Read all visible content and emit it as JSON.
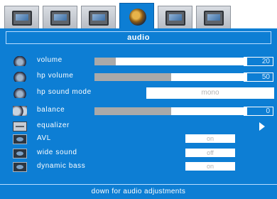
{
  "tabs": [
    {
      "icon": "tv-picture-icon",
      "active": false
    },
    {
      "icon": "tv-icon",
      "active": false
    },
    {
      "icon": "tv-settings-icon",
      "active": false
    },
    {
      "icon": "speaker-icon",
      "active": true
    },
    {
      "icon": "tv-features-icon",
      "active": false
    },
    {
      "icon": "tv-install-icon",
      "active": false
    }
  ],
  "panel": {
    "title": "audio"
  },
  "items": [
    {
      "label": "volume",
      "value": "20",
      "level": 0.14
    },
    {
      "label": "hp volume",
      "value": "50",
      "level": 0.5
    },
    {
      "label": "hp sound mode",
      "value": "mono"
    },
    {
      "label": "balance",
      "value": "0",
      "level": 0.5
    },
    {
      "label": "equalizer"
    },
    {
      "label": "AVL",
      "value": "on"
    },
    {
      "label": "wide sound",
      "value": "off"
    },
    {
      "label": "dynamic bass",
      "value": "on"
    }
  ],
  "footer": {
    "hint": "down for audio adjustments"
  },
  "colors": {
    "accent": "#0d7ed4",
    "slider_fill": "#a9a9a9",
    "disabled_text": "#b3b3b3"
  }
}
